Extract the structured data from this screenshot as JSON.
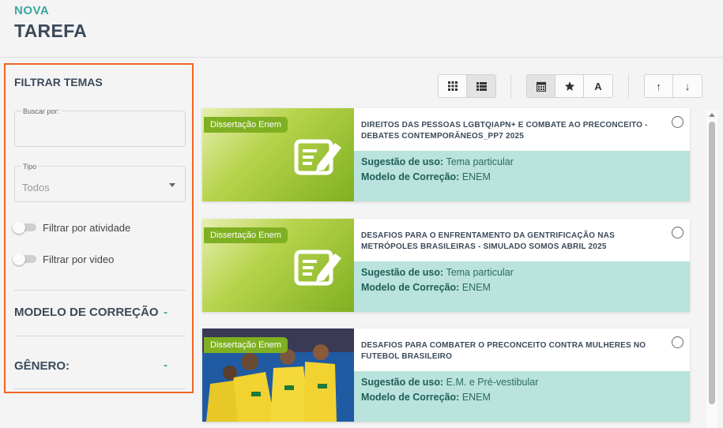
{
  "header": {
    "subtitle": "NOVA",
    "title": "TAREFA"
  },
  "sidebar": {
    "title": "FILTRAR TEMAS",
    "search": {
      "label": "Buscar por:",
      "value": "",
      "placeholder": ""
    },
    "type_select": {
      "label": "Tipo",
      "value": "Todos"
    },
    "toggles": [
      {
        "label": "Filtrar por atividade",
        "on": false
      },
      {
        "label": "Filtrar por video",
        "on": false
      }
    ],
    "sections": [
      {
        "label": "MODELO DE CORREÇÃO",
        "toggle": "-"
      },
      {
        "label": "GÊNERO:",
        "toggle": "-"
      }
    ]
  },
  "toolbar": {
    "view": [
      {
        "icon": "grid-icon",
        "active": false
      },
      {
        "icon": "list-icon",
        "active": true
      }
    ],
    "sort_by": [
      {
        "icon": "calendar-icon",
        "active": true
      },
      {
        "icon": "star-icon",
        "active": false
      },
      {
        "icon": "alpha-icon",
        "label": "A",
        "active": false
      }
    ],
    "order": [
      {
        "icon": "arrow-up-icon",
        "label": "↑"
      },
      {
        "icon": "arrow-down-icon",
        "label": "↓"
      }
    ]
  },
  "cards": [
    {
      "badge": "Dissertação Enem",
      "title": "DIREITOS DAS PESSOAS LGBTQIAPN+ E COMBATE AO PRECONCEITO - DEBATES CONTEMPORÂNEOS_PP7 2025",
      "usage_label": "Sugestão de uso:",
      "usage_value": "Tema particular",
      "model_label": "Modelo de Correção:",
      "model_value": "ENEM",
      "thumb": "document-icon"
    },
    {
      "badge": "Dissertação Enem",
      "title": "DESAFIOS PARA O ENFRENTAMENTO DA GENTRIFICAÇÃO NAS METRÓPOLES BRASILEIRAS - SIMULADO SOMOS ABRIL 2025",
      "usage_label": "Sugestão de uso:",
      "usage_value": "Tema particular",
      "model_label": "Modelo de Correção:",
      "model_value": "ENEM",
      "thumb": "document-icon"
    },
    {
      "badge": "Dissertação Enem",
      "title": "DESAFIOS PARA COMBATER O PRECONCEITO CONTRA MULHERES NO FUTEBOL BRASILEIRO",
      "usage_label": "Sugestão de uso:",
      "usage_value": "E.M. e Pré-vestibular",
      "model_label": "Modelo de Correção:",
      "model_value": "ENEM",
      "thumb": "photo"
    }
  ],
  "colors": {
    "accent": "#3aa89e",
    "highlight_border": "#f26522",
    "badge": "#7fb022",
    "meta_bg": "#b9e3dc",
    "heading": "#3b4a5a"
  }
}
